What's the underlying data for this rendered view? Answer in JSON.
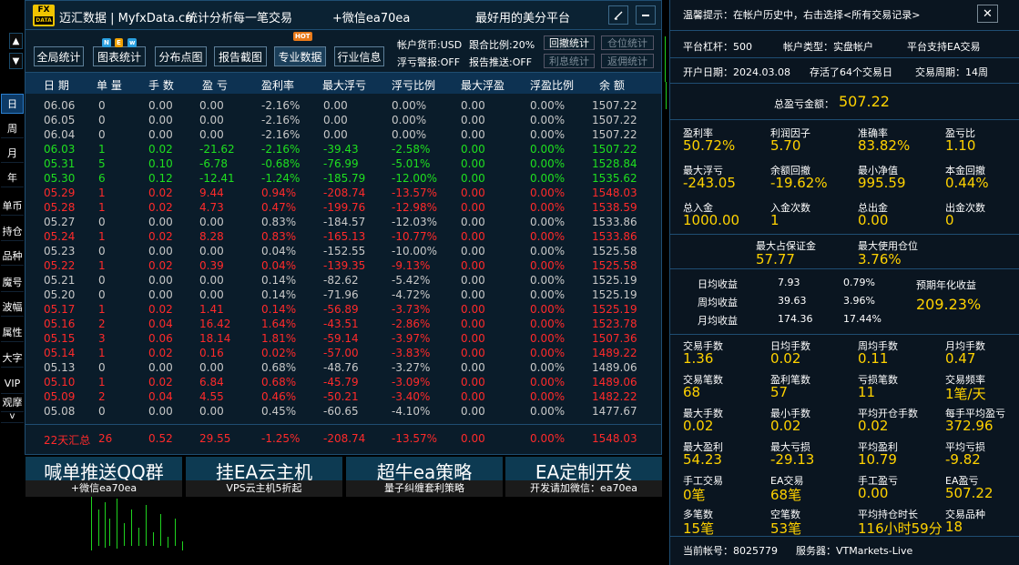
{
  "header": {
    "logo_top": "FX",
    "logo_bottom": "DATA",
    "brand": "迈汇数据 | MyfxData.cn",
    "slogan": "统计分析每一笔交易",
    "wechat": "+微信ea70ea",
    "platform_slogan": "最好用的美分平台"
  },
  "toolbar": {
    "buttons": [
      "全局统计",
      "图表统计",
      "分布点图",
      "报告截图",
      "专业数据",
      "行业信息"
    ],
    "badge_new": "N E w",
    "badge_hot": "HOT",
    "account_currency": "帐户货币:USD",
    "copy_ratio": "跟合比例:20%",
    "float_alert": "浮亏警报:OFF",
    "report_push": "报告推送:OFF",
    "small_buttons": [
      "回撤统计",
      "仓位统计",
      "利息统计",
      "返佣统计"
    ]
  },
  "left_nav": {
    "items": [
      "日",
      "周",
      "月",
      "年",
      "单币",
      "持仓",
      "品种",
      "魔号",
      "波幅",
      "属性",
      "大字",
      "VIP",
      "观摩"
    ],
    "up": "▲",
    "down": "▼",
    "collapse": "v"
  },
  "table": {
    "headers": [
      "日 期",
      "单 量",
      "手 数",
      "盈 亏",
      "盈利率",
      "最大浮亏",
      "浮亏比例",
      "最大浮盈",
      "浮盈比例",
      "余 额"
    ],
    "rows": [
      {
        "c": "gray",
        "v": [
          "06.06",
          "0",
          "0.00",
          "0.00",
          "-2.16%",
          "0.00",
          "0.00%",
          "0.00",
          "0.00%",
          "1507.22"
        ]
      },
      {
        "c": "gray",
        "v": [
          "06.05",
          "0",
          "0.00",
          "0.00",
          "-2.16%",
          "0.00",
          "0.00%",
          "0.00",
          "0.00%",
          "1507.22"
        ]
      },
      {
        "c": "gray",
        "v": [
          "06.04",
          "0",
          "0.00",
          "0.00",
          "-2.16%",
          "0.00",
          "0.00%",
          "0.00",
          "0.00%",
          "1507.22"
        ]
      },
      {
        "c": "green",
        "v": [
          "06.03",
          "1",
          "0.02",
          "-21.62",
          "-2.16%",
          "-39.43",
          "-2.58%",
          "0.00",
          "0.00%",
          "1507.22"
        ]
      },
      {
        "c": "green",
        "v": [
          "05.31",
          "5",
          "0.10",
          "-6.78",
          "-0.68%",
          "-76.99",
          "-5.01%",
          "0.00",
          "0.00%",
          "1528.84"
        ]
      },
      {
        "c": "green",
        "v": [
          "05.30",
          "6",
          "0.12",
          "-12.41",
          "-1.24%",
          "-185.79",
          "-12.00%",
          "0.00",
          "0.00%",
          "1535.62"
        ]
      },
      {
        "c": "red",
        "v": [
          "05.29",
          "1",
          "0.02",
          "9.44",
          "0.94%",
          "-208.74",
          "-13.57%",
          "0.00",
          "0.00%",
          "1548.03"
        ]
      },
      {
        "c": "red",
        "v": [
          "05.28",
          "1",
          "0.02",
          "4.73",
          "0.47%",
          "-199.76",
          "-12.98%",
          "0.00",
          "0.00%",
          "1538.59"
        ]
      },
      {
        "c": "gray",
        "v": [
          "05.27",
          "0",
          "0.00",
          "0.00",
          "0.83%",
          "-184.57",
          "-12.03%",
          "0.00",
          "0.00%",
          "1533.86"
        ]
      },
      {
        "c": "red",
        "v": [
          "05.24",
          "1",
          "0.02",
          "8.28",
          "0.83%",
          "-165.13",
          "-10.77%",
          "0.00",
          "0.00%",
          "1533.86"
        ]
      },
      {
        "c": "gray",
        "v": [
          "05.23",
          "0",
          "0.00",
          "0.00",
          "0.04%",
          "-152.55",
          "-10.00%",
          "0.00",
          "0.00%",
          "1525.58"
        ]
      },
      {
        "c": "red",
        "v": [
          "05.22",
          "1",
          "0.02",
          "0.39",
          "0.04%",
          "-139.35",
          "-9.13%",
          "0.00",
          "0.00%",
          "1525.58"
        ]
      },
      {
        "c": "gray",
        "v": [
          "05.21",
          "0",
          "0.00",
          "0.00",
          "0.14%",
          "-82.62",
          "-5.42%",
          "0.00",
          "0.00%",
          "1525.19"
        ]
      },
      {
        "c": "gray",
        "v": [
          "05.20",
          "0",
          "0.00",
          "0.00",
          "0.14%",
          "-71.96",
          "-4.72%",
          "0.00",
          "0.00%",
          "1525.19"
        ]
      },
      {
        "c": "red",
        "v": [
          "05.17",
          "1",
          "0.02",
          "1.41",
          "0.14%",
          "-56.89",
          "-3.73%",
          "0.00",
          "0.00%",
          "1525.19"
        ]
      },
      {
        "c": "red",
        "v": [
          "05.16",
          "2",
          "0.04",
          "16.42",
          "1.64%",
          "-43.51",
          "-2.86%",
          "0.00",
          "0.00%",
          "1523.78"
        ]
      },
      {
        "c": "red",
        "v": [
          "05.15",
          "3",
          "0.06",
          "18.14",
          "1.81%",
          "-59.14",
          "-3.97%",
          "0.00",
          "0.00%",
          "1507.36"
        ]
      },
      {
        "c": "red",
        "v": [
          "05.14",
          "1",
          "0.02",
          "0.16",
          "0.02%",
          "-57.00",
          "-3.83%",
          "0.00",
          "0.00%",
          "1489.22"
        ]
      },
      {
        "c": "gray",
        "v": [
          "05.13",
          "0",
          "0.00",
          "0.00",
          "0.68%",
          "-48.76",
          "-3.27%",
          "0.00",
          "0.00%",
          "1489.06"
        ]
      },
      {
        "c": "red",
        "v": [
          "05.10",
          "1",
          "0.02",
          "6.84",
          "0.68%",
          "-45.79",
          "-3.09%",
          "0.00",
          "0.00%",
          "1489.06"
        ]
      },
      {
        "c": "red",
        "v": [
          "05.09",
          "2",
          "0.04",
          "4.55",
          "0.46%",
          "-50.21",
          "-3.40%",
          "0.00",
          "0.00%",
          "1482.22"
        ]
      },
      {
        "c": "gray",
        "v": [
          "05.08",
          "0",
          "0.00",
          "0.00",
          "0.45%",
          "-60.65",
          "-4.10%",
          "0.00",
          "0.00%",
          "1477.67"
        ]
      }
    ],
    "summary": [
      "22天汇总",
      "26",
      "0.52",
      "29.55",
      "-1.25%",
      "-208.74",
      "-13.57%",
      "0.00",
      "0.00%",
      "1548.03"
    ]
  },
  "ads": [
    {
      "big": "喊单推送QQ群",
      "sub": "+微信ea70ea"
    },
    {
      "big": "挂EA云主机",
      "sub": "VPS云主机5折起"
    },
    {
      "big": "超牛ea策略",
      "sub": "量子纠缠套利策略"
    },
    {
      "big": "EA定制开发",
      "sub": "开发请加微信：ea70ea"
    }
  ],
  "right": {
    "tip": "温馨提示：在帐户历史中，右击选择<所有交易记录>",
    "close": "✕",
    "leverage": "平台杠杆：500",
    "acct_type": "帐户类型：实盘帐户",
    "ea_support": "平台支持EA交易",
    "open_date": "开户日期：2024.03.08",
    "survived": "存活了64个交易日",
    "period": "交易周期：14周",
    "total_pl_label": "总盈亏金额：",
    "total_pl": "507.22",
    "stats1": [
      {
        "l": "盈利率",
        "v": "50.72%"
      },
      {
        "l": "利润因子",
        "v": "5.70"
      },
      {
        "l": "准确率",
        "v": "83.82%"
      },
      {
        "l": "盈亏比",
        "v": "1.10"
      },
      {
        "l": "最大浮亏",
        "v": "-243.05"
      },
      {
        "l": "余额回撤",
        "v": "-19.62%"
      },
      {
        "l": "最小净值",
        "v": "995.59"
      },
      {
        "l": "本金回撤",
        "v": "0.44%"
      },
      {
        "l": "总入金",
        "v": "1000.00"
      },
      {
        "l": "入金次数",
        "v": "1"
      },
      {
        "l": "总出金",
        "v": "0.00"
      },
      {
        "l": "出金次数",
        "v": "0"
      }
    ],
    "margin_label": "最大占保证金",
    "margin": "57.77",
    "maxpos_label": "最大使用仓位",
    "maxpos": "3.76%",
    "avg": [
      {
        "l": "日均收益",
        "a": "7.93",
        "p": "0.79%"
      },
      {
        "l": "周均收益",
        "a": "39.63",
        "p": "3.96%"
      },
      {
        "l": "月均收益",
        "a": "174.36",
        "p": "17.44%"
      }
    ],
    "annual_label": "预期年化收益",
    "annual": "209.23%",
    "stats2": [
      {
        "l": "交易手数",
        "v": "1.36"
      },
      {
        "l": "日均手数",
        "v": "0.02"
      },
      {
        "l": "周均手数",
        "v": "0.11"
      },
      {
        "l": "月均手数",
        "v": "0.47"
      },
      {
        "l": "交易笔数",
        "v": "68"
      },
      {
        "l": "盈利笔数",
        "v": "57"
      },
      {
        "l": "亏损笔数",
        "v": "11"
      },
      {
        "l": "交易频率",
        "v": "1笔/天"
      },
      {
        "l": "最大手数",
        "v": "0.02"
      },
      {
        "l": "最小手数",
        "v": "0.02"
      },
      {
        "l": "平均开仓手数",
        "v": "0.02"
      },
      {
        "l": "每手平均盈亏",
        "v": "372.96"
      },
      {
        "l": "最大盈利",
        "v": "54.23"
      },
      {
        "l": "最大亏损",
        "v": "-29.13"
      },
      {
        "l": "平均盈利",
        "v": "10.79"
      },
      {
        "l": "平均亏损",
        "v": "-9.82"
      },
      {
        "l": "手工交易",
        "v": "0笔"
      },
      {
        "l": "EA交易",
        "v": "68笔"
      },
      {
        "l": "手工盈亏",
        "v": "0.00"
      },
      {
        "l": "EA盈亏",
        "v": "507.22"
      },
      {
        "l": "多笔数",
        "v": "15笔"
      },
      {
        "l": "空笔数",
        "v": "53笔"
      },
      {
        "l": "平均持仓时长",
        "v": "116小时59分"
      },
      {
        "l": "交易品种",
        "v": "18"
      }
    ],
    "account": "当前帐号：8025779",
    "server": "服务器：VTMarkets-Live"
  }
}
